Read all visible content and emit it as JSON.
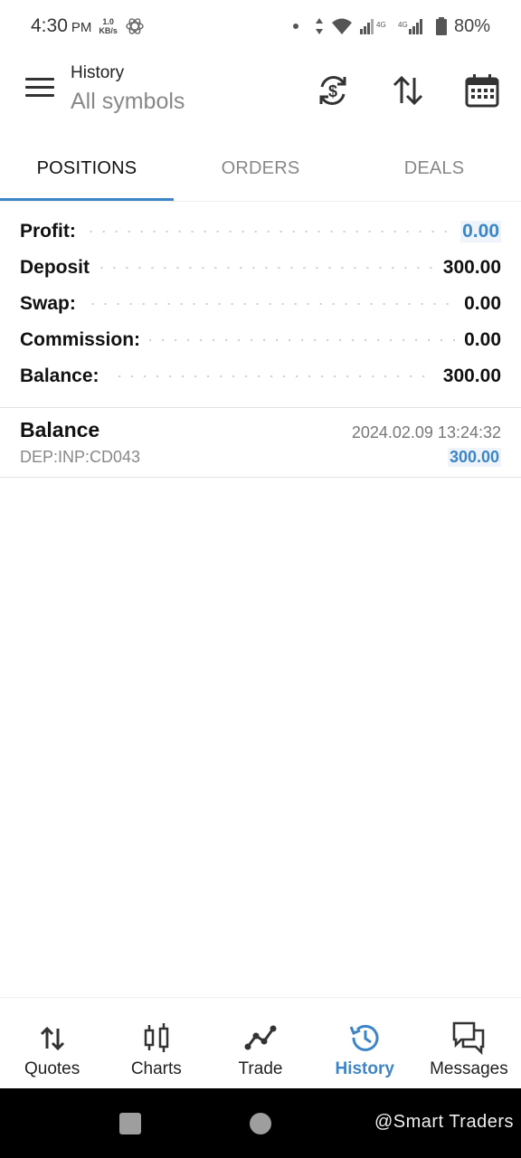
{
  "status_bar": {
    "time": "4:30",
    "ampm": "PM",
    "speed_value": "1.0",
    "speed_unit": "KB/s",
    "battery": "80%"
  },
  "header": {
    "subtitle": "History",
    "title": "All symbols"
  },
  "tabs": [
    {
      "label": "POSITIONS",
      "active": true
    },
    {
      "label": "ORDERS",
      "active": false
    },
    {
      "label": "DEALS",
      "active": false
    }
  ],
  "summary": {
    "profit_label": "Profit:",
    "profit_value": "0.00",
    "deposit_label": "Deposit",
    "deposit_value": "300.00",
    "swap_label": "Swap:",
    "swap_value": "0.00",
    "commission_label": "Commission:",
    "commission_value": "0.00",
    "balance_label": "Balance:",
    "balance_value": "300.00"
  },
  "deals": [
    {
      "title": "Balance",
      "comment": "DEP:INP:CD043",
      "time": "2024.02.09 13:24:32",
      "amount": "300.00"
    }
  ],
  "bottom_nav": [
    {
      "label": "Quotes",
      "icon": "quotes-icon",
      "active": false
    },
    {
      "label": "Charts",
      "icon": "charts-icon",
      "active": false
    },
    {
      "label": "Trade",
      "icon": "trade-icon",
      "active": false
    },
    {
      "label": "History",
      "icon": "history-icon",
      "active": true
    },
    {
      "label": "Messages",
      "icon": "messages-icon",
      "active": false
    }
  ],
  "watermark": "@Smart Traders",
  "colors": {
    "accent": "#3d85c6",
    "highlight_bg": "#eef4fa",
    "muted_text": "#888888"
  }
}
